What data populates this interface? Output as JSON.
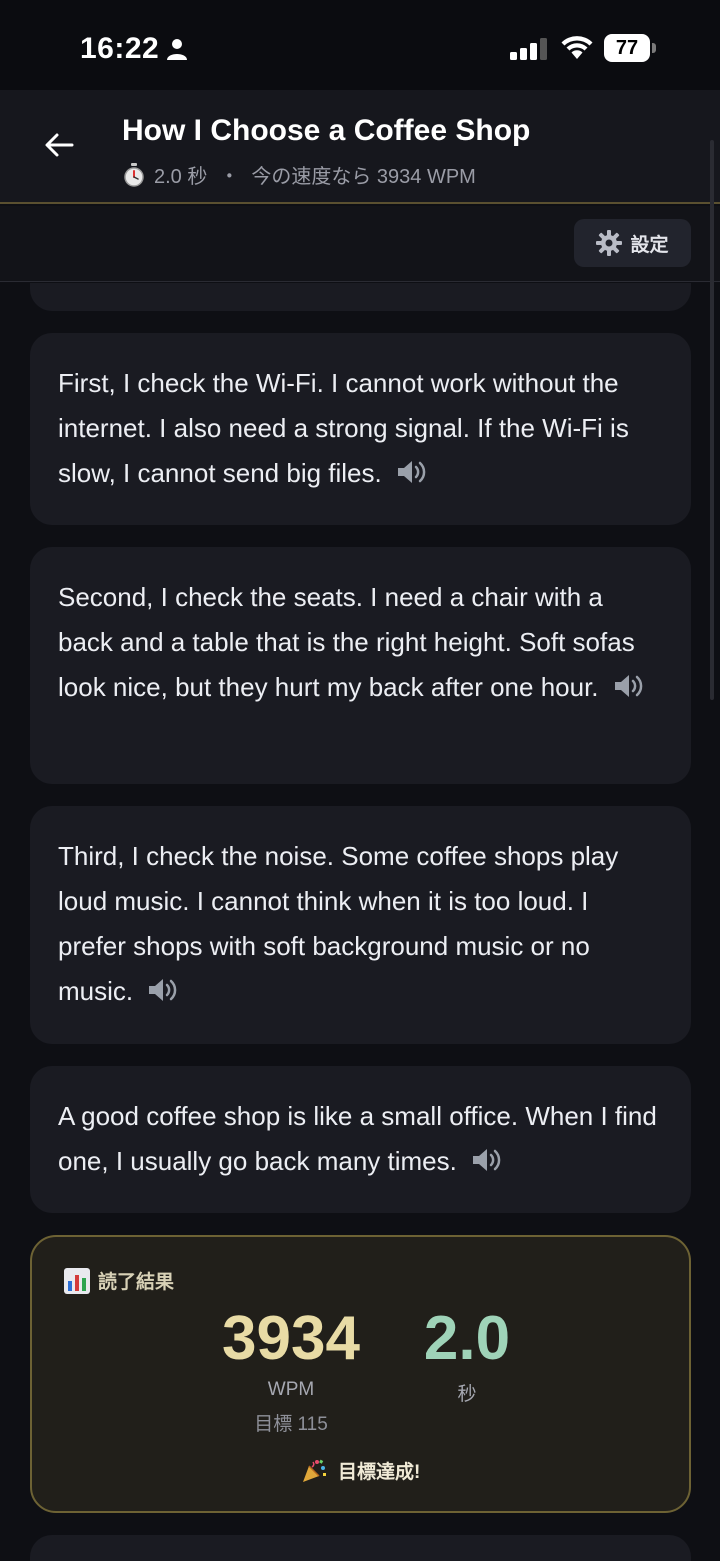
{
  "status_bar": {
    "time": "16:22",
    "battery": "77",
    "icons": [
      "person-icon",
      "signal-icon",
      "wifi-icon",
      "battery-icon"
    ]
  },
  "header": {
    "title": "How I Choose a Coffee Shop",
    "time_value": "2.0 秒",
    "separator": "・",
    "speed_text": "今の速度なら 3934 WPM",
    "icons": [
      "back-arrow-icon",
      "stopwatch-icon"
    ]
  },
  "toolbar": {
    "settings_label": "設定",
    "icons": [
      "gear-icon"
    ]
  },
  "paragraphs": [
    {
      "text": "First, I check the Wi-Fi. I cannot work without the internet. I also need a strong signal. If the Wi-Fi is slow, I cannot send big files."
    },
    {
      "text": "Second, I check the seats. I need a chair with a back and a table that is the right height. Soft sofas look nice, but they hurt my back after one hour."
    },
    {
      "text": "Third, I check the noise. Some coffee shops play loud music. I cannot think when it is too loud. I prefer shops with soft background music or no music."
    },
    {
      "text": "A good coffee shop is like a small office. When I find one, I usually go back many times."
    }
  ],
  "result": {
    "label": "読了結果",
    "wpm": "3934",
    "wpm_unit": "WPM",
    "goal": "目標 115",
    "seconds": "2.0",
    "seconds_unit": "秒",
    "achieved": "目標達成!",
    "icons": [
      "bar-chart-icon",
      "party-popper-icon"
    ]
  },
  "colors": {
    "background": "#0e0f14",
    "card": "#1a1b22",
    "result_border": "#6d6234",
    "wpm_color": "#e8dba5",
    "seconds_color": "#9fd3b8"
  }
}
